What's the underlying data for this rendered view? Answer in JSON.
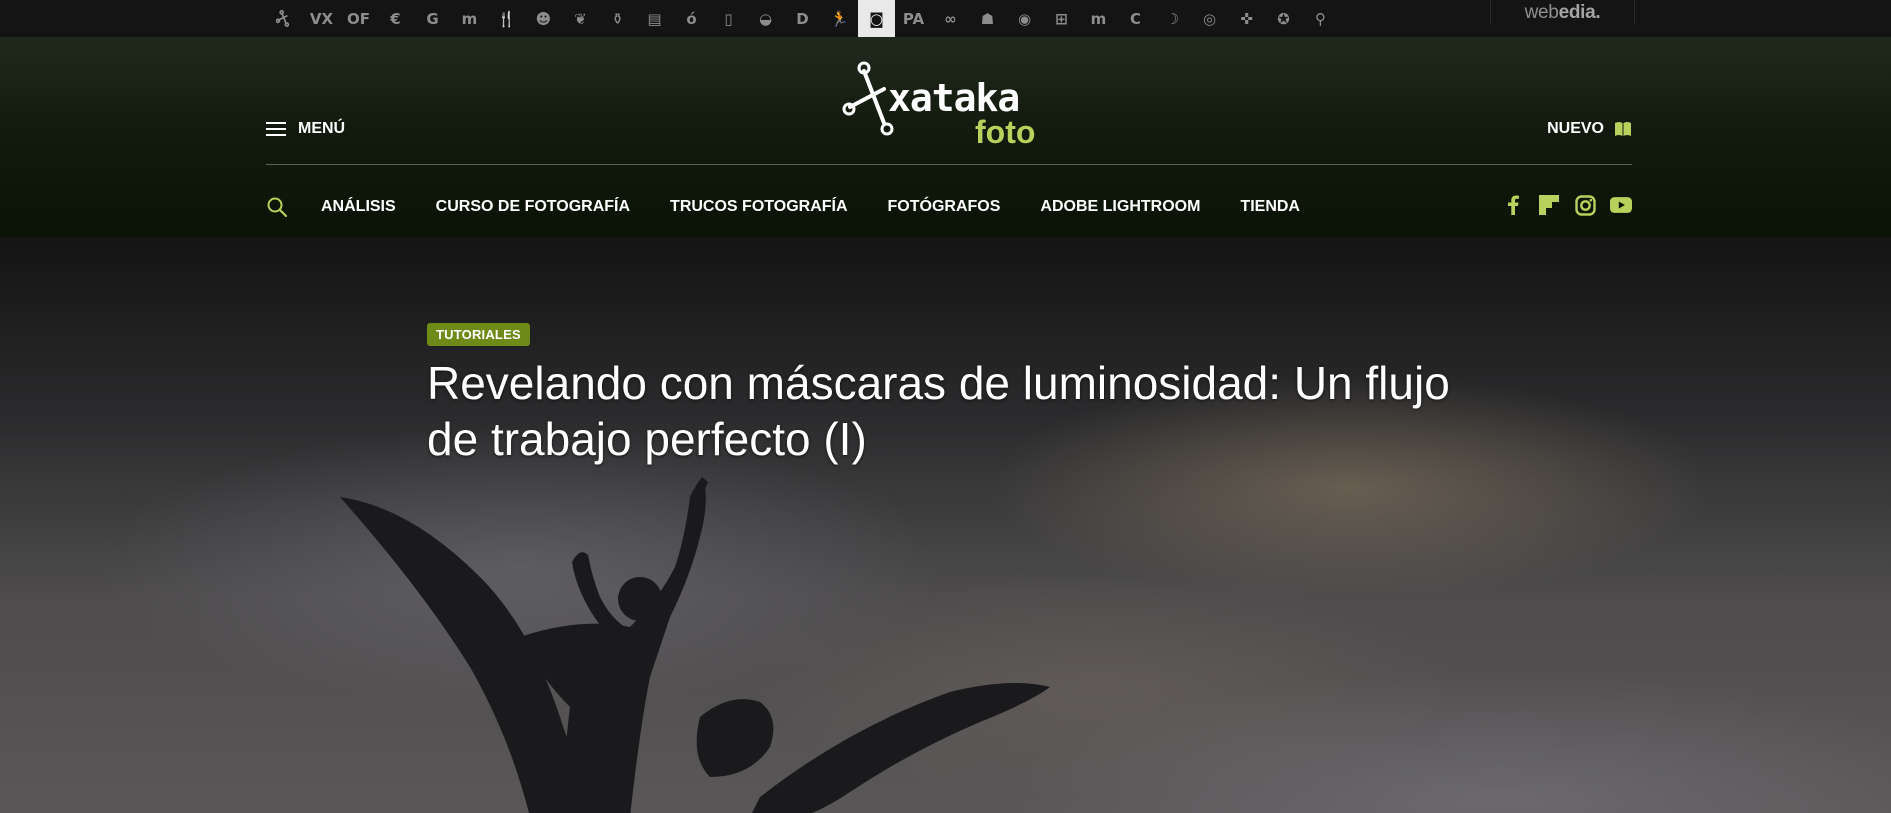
{
  "network_bar": {
    "icons": [
      {
        "name": "xataka-icon",
        "glyph": ""
      },
      {
        "name": "vx-icon",
        "glyph": "VX"
      },
      {
        "name": "of-icon",
        "glyph": "OF"
      },
      {
        "name": "euro-icon",
        "glyph": "€"
      },
      {
        "name": "g-icon",
        "glyph": "G"
      },
      {
        "name": "m-icon",
        "glyph": "m"
      },
      {
        "name": "fork-knife-icon",
        "glyph": "🍴"
      },
      {
        "name": "baby-icon",
        "glyph": "☻"
      },
      {
        "name": "leaf-icon",
        "glyph": "❦"
      },
      {
        "name": "bottle-icon",
        "glyph": "⚱"
      },
      {
        "name": "briefcase-icon",
        "glyph": "▤"
      },
      {
        "name": "apple-icon",
        "glyph": "ó"
      },
      {
        "name": "phone-icon",
        "glyph": "▯"
      },
      {
        "name": "helmet-icon",
        "glyph": "◒"
      },
      {
        "name": "d-icon",
        "glyph": "D"
      },
      {
        "name": "runner-icon",
        "glyph": "🏃"
      },
      {
        "name": "camera-icon",
        "glyph": "◙"
      },
      {
        "name": "pa-icon",
        "glyph": "PA"
      },
      {
        "name": "glasses-icon",
        "glyph": "∞"
      },
      {
        "name": "android-icon",
        "glyph": "☗"
      },
      {
        "name": "rss-disc-icon",
        "glyph": "◉"
      },
      {
        "name": "windows-icon",
        "glyph": "⊞"
      },
      {
        "name": "magnet-icon",
        "glyph": "m"
      },
      {
        "name": "c-icon",
        "glyph": "C"
      },
      {
        "name": "moon-icon",
        "glyph": "☽"
      },
      {
        "name": "target-icon",
        "glyph": "◎"
      },
      {
        "name": "gamepad-icon",
        "glyph": "✜"
      },
      {
        "name": "badge-icon",
        "glyph": "✪"
      },
      {
        "name": "pin-icon",
        "glyph": "⚲"
      }
    ],
    "active_index": 16,
    "brand": {
      "prefix": "web",
      "suffix": "edia."
    }
  },
  "header": {
    "menu_label": "MENÚ",
    "logo": {
      "word": "xataka",
      "sub": "foto"
    },
    "nuevo_label": "NUEVO",
    "accent": "#b6d25c",
    "nav": [
      "ANÁLISIS",
      "CURSO DE FOTOGRAFÍA",
      "TRUCOS FOTOGRAFÍA",
      "FOTÓGRAFOS",
      "ADOBE LIGHTROOM",
      "TIENDA"
    ],
    "social": [
      "facebook-icon",
      "flipboard-icon",
      "instagram-icon",
      "youtube-icon"
    ]
  },
  "article": {
    "category": "TUTORIALES",
    "category_color": "#6e8b19",
    "title": "Revelando con máscaras de luminosidad: Un flujo de trabajo perfecto (I)"
  }
}
